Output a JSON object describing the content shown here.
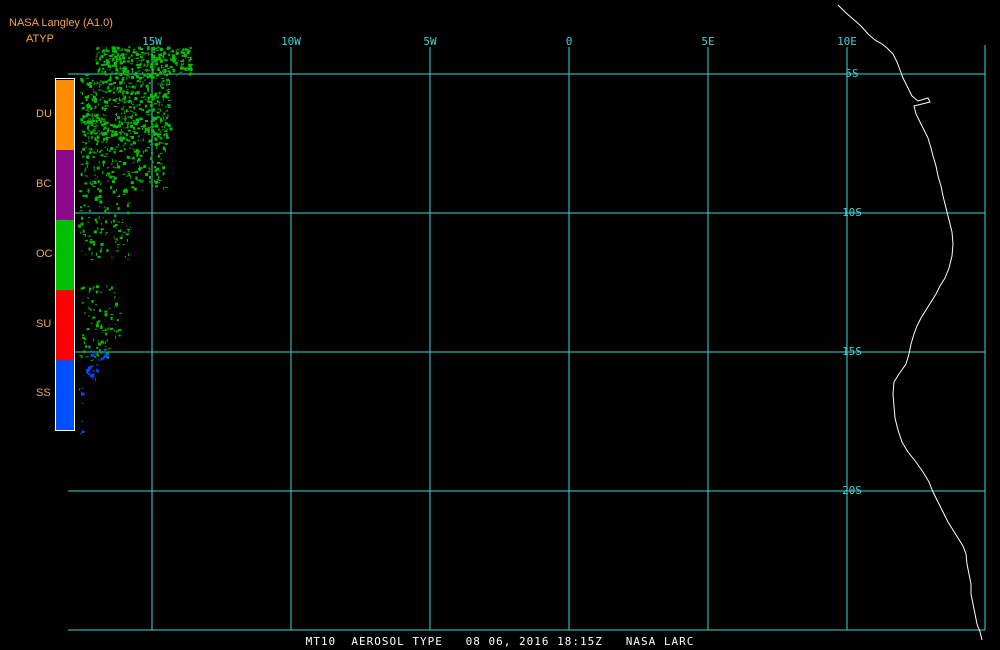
{
  "header": {
    "title": "NASA Langley (A1.0)",
    "product": "ATYP"
  },
  "legend": {
    "items": [
      {
        "code": "DU",
        "color": "#ff8c00"
      },
      {
        "code": "BC",
        "color": "#8b0a8b"
      },
      {
        "code": "OC",
        "color": "#00c000"
      },
      {
        "code": "SU",
        "color": "#ff0000"
      },
      {
        "code": "SS",
        "color": "#0050ff"
      }
    ]
  },
  "grid": {
    "color": "#3fd3d3",
    "longitude_labels": [
      "15W",
      "10W",
      "5W",
      "0",
      "5E",
      "10E"
    ],
    "latitude_labels": [
      "5S",
      "10S",
      "15S",
      "20S"
    ]
  },
  "footer": {
    "text": "MT10  AEROSOL TYPE   08 06, 2016 18:15Z   NASA LARC"
  },
  "coastline_color": "#ffffff"
}
